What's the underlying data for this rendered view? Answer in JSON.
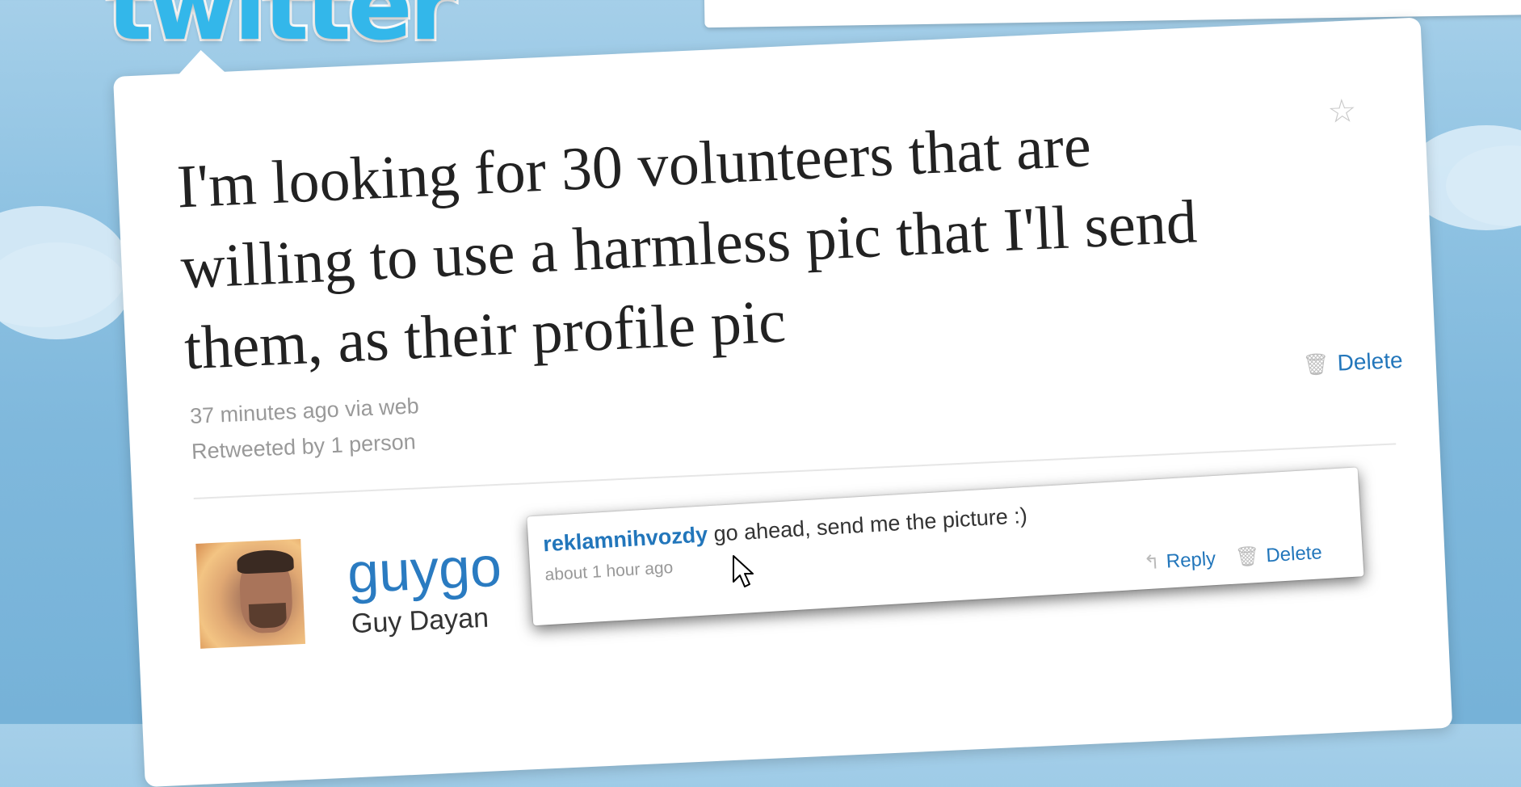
{
  "app": {
    "logo_text": "twitter"
  },
  "tweet": {
    "text": "I'm looking for 30 volunteers that are willing to use a harmless pic that I'll send them, as their profile pic",
    "time": "37 minutes ago",
    "via_prefix": "via",
    "via_source": "web",
    "retweeted": "Retweeted by 1 person",
    "delete_label": "Delete",
    "favorite_icon": "star-icon"
  },
  "user": {
    "username": "guygo",
    "full_name": "Guy Dayan"
  },
  "reply": {
    "author": "reklamnihvozdy",
    "text": "go ahead, send me the picture :)",
    "time": "about 1 hour ago",
    "reply_label": "Reply",
    "delete_label": "Delete"
  },
  "colors": {
    "link": "#2276bb",
    "username": "#2a7bc1",
    "logo": "#33b7ea",
    "background": "#8ec2e2"
  }
}
